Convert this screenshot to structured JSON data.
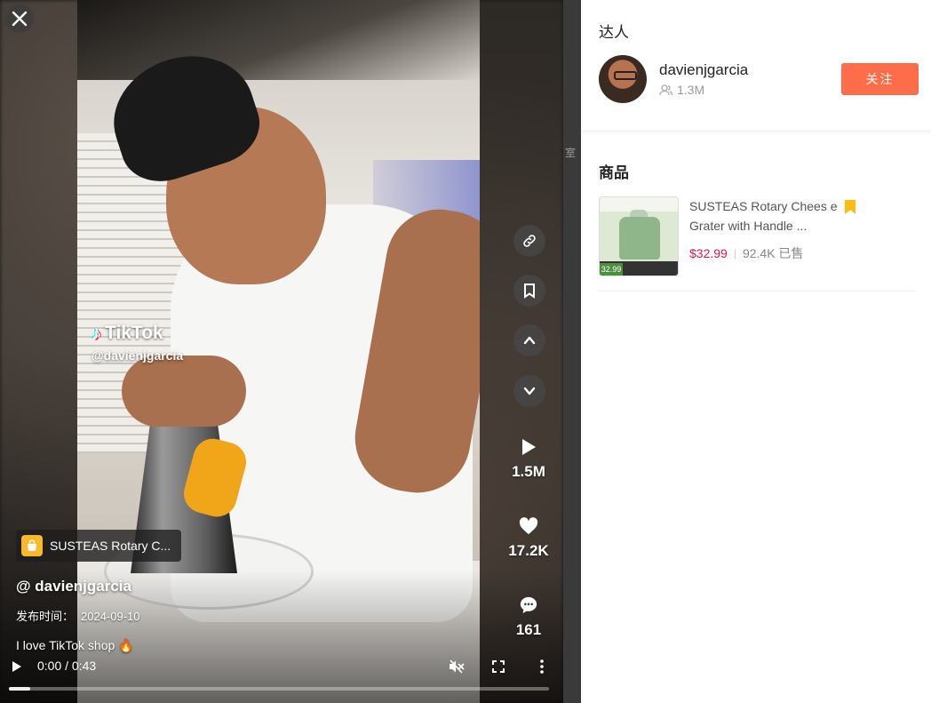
{
  "player": {
    "watermark_logo": "TikTok",
    "watermark_user": "@davienjgarcia",
    "stats": {
      "plays": "1.5M",
      "likes": "17.2K",
      "comments": "161"
    },
    "product_chip": "SUSTEAS Rotary C...",
    "author": "@ davienjgarcia",
    "publish_label": "发布时间：",
    "publish_date": "2024-09-10",
    "caption": "I love TikTok shop 🔥",
    "time": "0:00 / 0:43",
    "progress": 0.04,
    "side_peek_text": "室"
  },
  "panel": {
    "creator_section_title": "达人",
    "creator": {
      "name": "davienjgarcia",
      "followers": "1.3M",
      "follow_label": "关注"
    },
    "products_section_title": "商品",
    "product": {
      "title": "SUSTEAS Rotary Chees e Grater with Handle ...",
      "price": "$32.99",
      "sold": "92.4K 已售",
      "thumb_price": "32.99"
    }
  },
  "colors": {
    "follow_button": "#fd6d4a",
    "price": "#e0174a",
    "bookmark": "#fcbc10",
    "chip_icon": "#fbb82b"
  }
}
